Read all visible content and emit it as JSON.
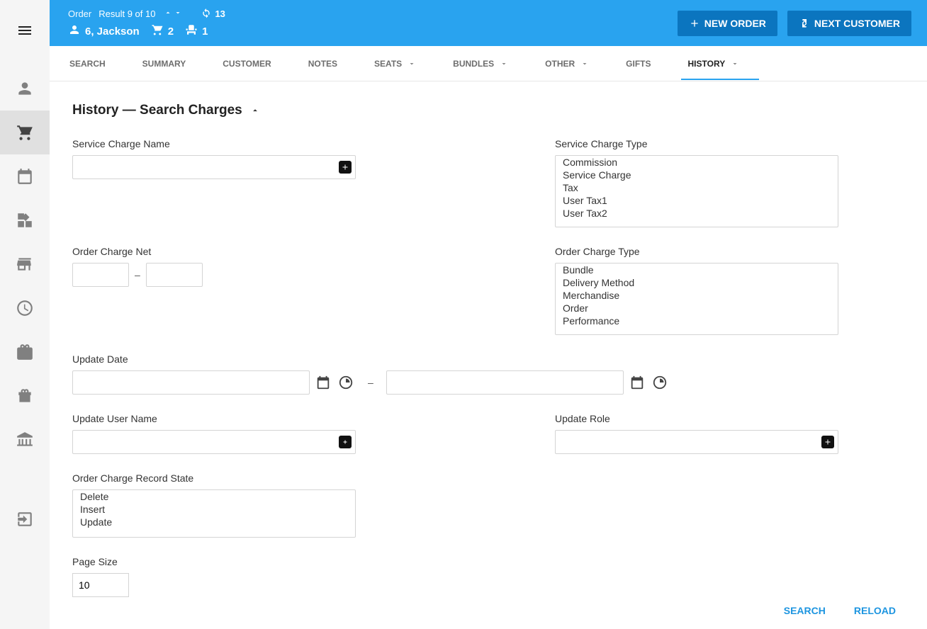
{
  "header": {
    "order_label": "Order",
    "result_text": "Result 9 of 10",
    "refresh_count": "13",
    "customer_name": "6, Jackson",
    "cart_count": "2",
    "seat_count": "1",
    "new_order_btn": "NEW ORDER",
    "next_customer_btn": "NEXT CUSTOMER"
  },
  "tabs": {
    "search": "SEARCH",
    "summary": "SUMMARY",
    "customer": "CUSTOMER",
    "notes": "NOTES",
    "seats": "SEATS",
    "bundles": "BUNDLES",
    "other": "OTHER",
    "gifts": "GIFTS",
    "history": "HISTORY"
  },
  "section": {
    "title": "History — Search Charges"
  },
  "labels": {
    "service_charge_name": "Service Charge Name",
    "service_charge_type": "Service Charge Type",
    "order_charge_net": "Order Charge Net",
    "order_charge_type": "Order Charge Type",
    "update_date": "Update Date",
    "update_user_name": "Update User Name",
    "update_role": "Update Role",
    "order_charge_record_state": "Order Charge Record State",
    "page_size": "Page Size",
    "range_sep": "–"
  },
  "service_charge_types": [
    "Commission",
    "Service Charge",
    "Tax",
    "User Tax1",
    "User Tax2"
  ],
  "order_charge_types": [
    "Bundle",
    "Delivery Method",
    "Merchandise",
    "Order",
    "Performance"
  ],
  "record_states": [
    "Delete",
    "Insert",
    "Update"
  ],
  "page_size_value": "10",
  "footer": {
    "search": "SEARCH",
    "reload": "RELOAD"
  }
}
